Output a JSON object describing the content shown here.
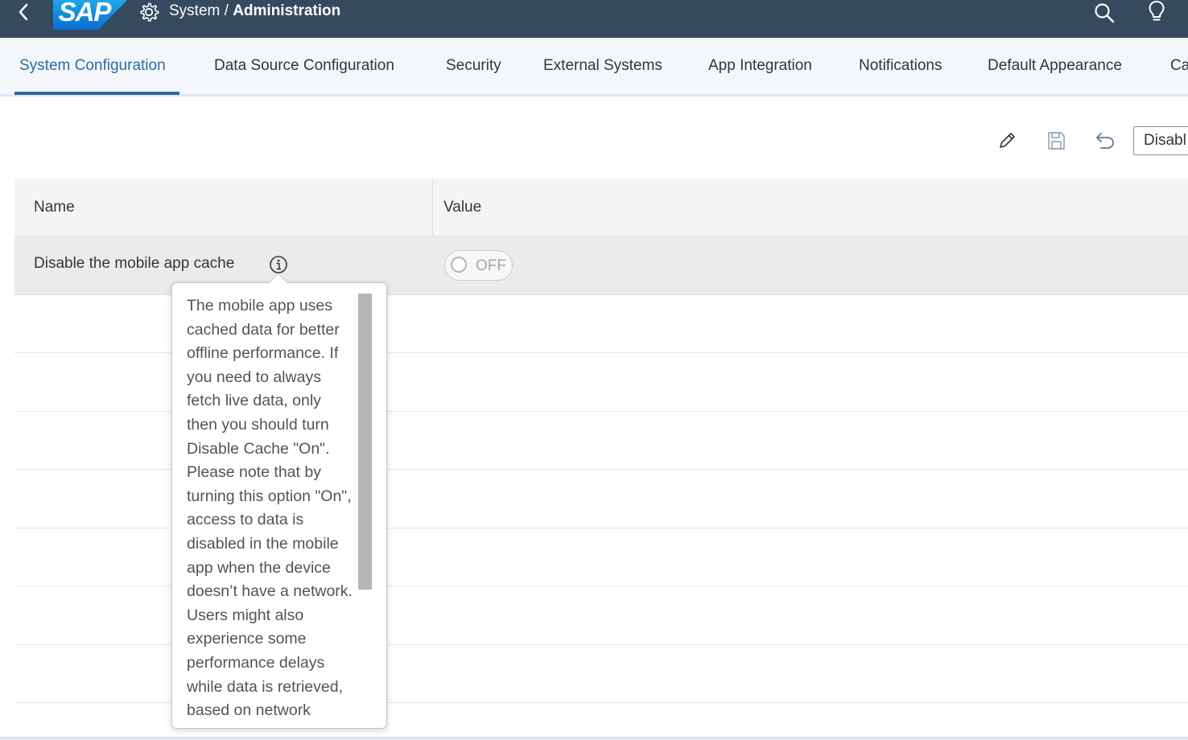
{
  "shell": {
    "logo_text": "SAP",
    "title_prefix": "System / ",
    "title_main": "Administration",
    "icons": [
      "back-icon",
      "gear-icon",
      "search-icon",
      "lightbulb-icon"
    ]
  },
  "tabs": [
    {
      "label": "System Configuration",
      "active": true
    },
    {
      "label": "Data Source Configuration"
    },
    {
      "label": "Security"
    },
    {
      "label": "External Systems"
    },
    {
      "label": "App Integration"
    },
    {
      "label": "Notifications"
    },
    {
      "label": "Default Appearance"
    },
    {
      "label": "Ca"
    }
  ],
  "toolbar": {
    "icons": [
      "edit-icon",
      "save-icon",
      "undo-icon"
    ],
    "dropdown_value": "Disabl"
  },
  "table": {
    "headers": {
      "name": "Name",
      "value": "Value"
    },
    "rows": [
      {
        "name": "Disable the mobile app cache",
        "value": "OFF"
      }
    ]
  },
  "popover": {
    "text": "The mobile app uses cached data for better offline performance. If you need to always fetch live data, only then you should turn Disable Cache \"On\". Please note that by turning this option \"On\", access to data is disabled in the mobile app when the device doesn’t have a network. Users might also experience some performance delays while data is retrieved, based on network conditions and"
  },
  "colors": {
    "shell_bg": "#354a5f",
    "accent": "#2a6aa6",
    "tabbar_bg": "#f4f7f9",
    "selected_row": "#ebebeb"
  }
}
